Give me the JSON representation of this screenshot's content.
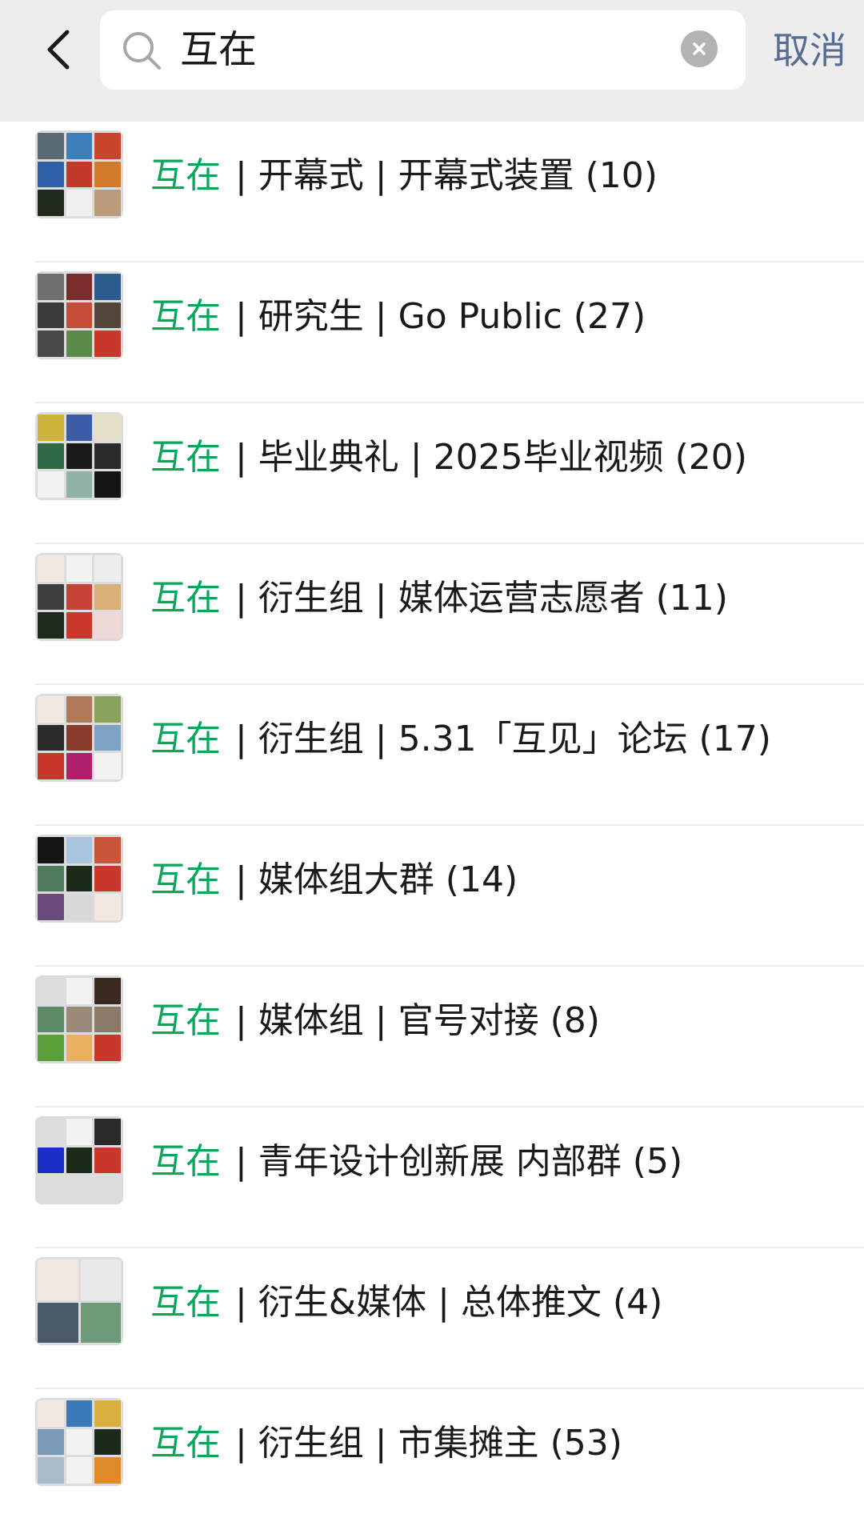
{
  "search": {
    "query": "互在",
    "cancel_label": "取消"
  },
  "colors": {
    "highlight": "#07a85a",
    "cancel": "#576b95",
    "topbar_bg": "#ededed"
  },
  "results": [
    {
      "keyword": "互在",
      "rest": "| 开幕式 | 开幕式装置 (10)"
    },
    {
      "keyword": "互在",
      "rest": "| 研究生 |  Go Public (27)"
    },
    {
      "keyword": "互在",
      "rest": "| 毕业典礼 |  2025毕业视频 (20)"
    },
    {
      "keyword": "互在",
      "rest": "| 衍生组 | 媒体运营志愿者 (11)"
    },
    {
      "keyword": "互在",
      "rest": "| 衍生组 |  5.31「互见」论坛 (17)"
    },
    {
      "keyword": "互在",
      "rest": "| 媒体组大群 (14)"
    },
    {
      "keyword": "互在",
      "rest": "| 媒体组 | 官号对接 (8)"
    },
    {
      "keyword": "互在",
      "rest": "| 青年设计创新展 内部群 (5)"
    },
    {
      "keyword": "互在",
      "rest": "| 衍生&媒体 | 总体推文 (4)"
    },
    {
      "keyword": "互在",
      "rest": "| 衍生组 | 市集摊主 (53)"
    }
  ]
}
